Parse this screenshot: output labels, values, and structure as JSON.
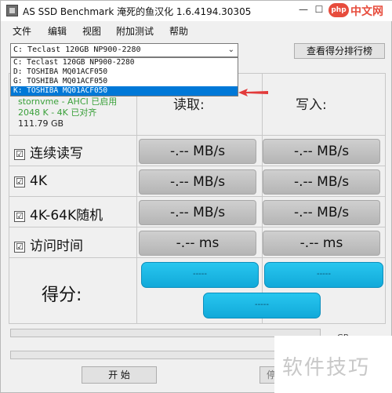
{
  "window": {
    "title": "AS SSD Benchmark 淹死的鱼汉化 1.6.4194.30305",
    "minimize_glyph": "—",
    "maximize_glyph": "☐",
    "logo_badge": "php",
    "logo_text": "中文网"
  },
  "menu": [
    "文件",
    "编辑",
    "视图",
    "附加测试",
    "帮助"
  ],
  "drive": {
    "selected": "C: Teclast 120GB NP900-2280",
    "options": [
      "C: Teclast 120GB NP900-2280",
      "D: TOSHIBA MQ01ACF050",
      "G: TOSHIBA MQ01ACF050",
      "K: TOSHIBA MQ01ACF050"
    ],
    "highlighted_index": 3
  },
  "ranking_button": "查看得分排行榜",
  "info": {
    "driver": "stornvme - AHCI 已启用",
    "alignment": "2048 K - 4K 已对齐",
    "size": "111.79 GB"
  },
  "headers": {
    "read": "读取:",
    "write": "写入:"
  },
  "rows": [
    {
      "label": "连续读写",
      "read": "-.-- MB/s",
      "write": "-.-- MB/s"
    },
    {
      "label": "4K",
      "read": "-.-- MB/s",
      "write": "-.-- MB/s"
    },
    {
      "label": "4K-64K随机",
      "read": "-.-- MB/s",
      "write": "-.-- MB/s"
    },
    {
      "label": "访问时间",
      "read": "-.-- ms",
      "write": "-.-- ms"
    }
  ],
  "checkbox_glyph": "☑",
  "score": {
    "label": "得分:",
    "read": "-----",
    "write": "-----",
    "total": "-----"
  },
  "status": {
    "size_text": "-.-- GB"
  },
  "buttons": {
    "start": "开 始",
    "abort": "停"
  },
  "watermark": "软件技巧",
  "colors": {
    "score_fill": "#1bb8e6",
    "result_fill": "#c4c4c4",
    "info_green": "#3aa03a",
    "selection": "#0078d7",
    "arrow": "#e23b3b"
  }
}
